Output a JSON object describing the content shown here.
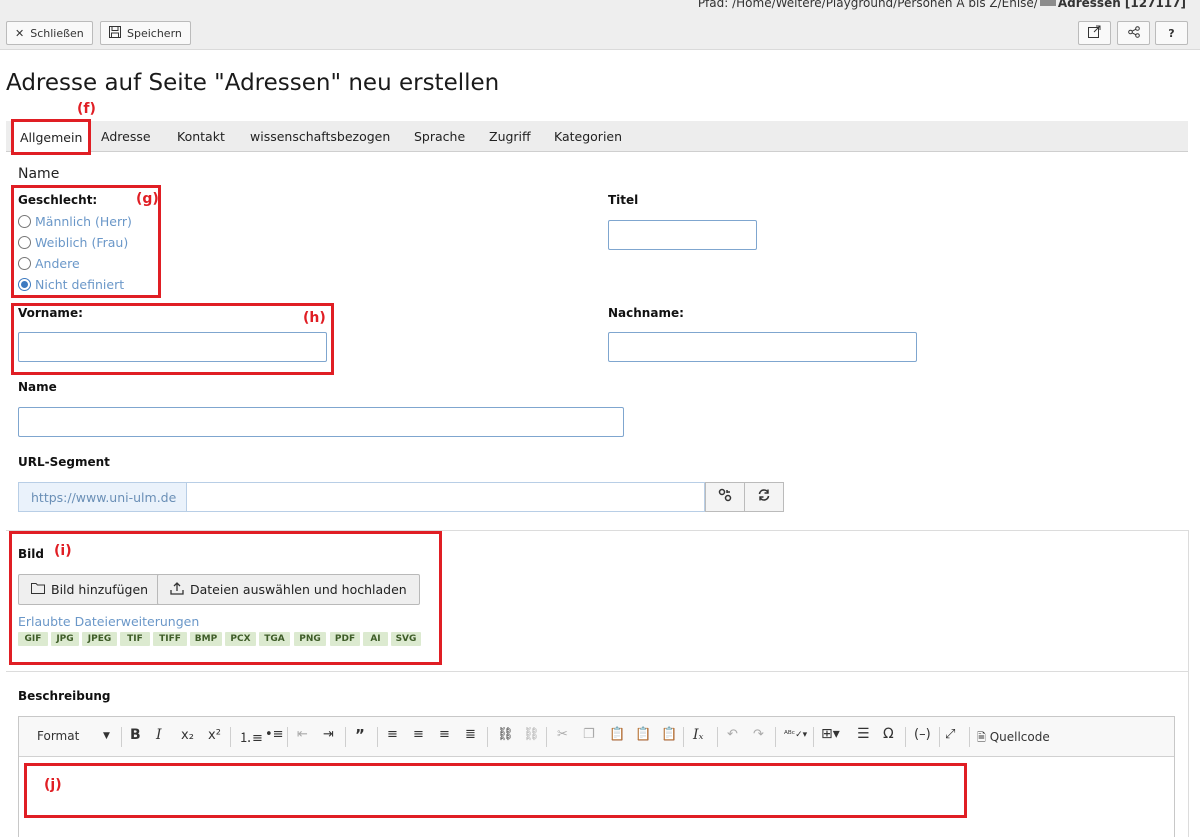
{
  "topbar": {
    "path_prefix": "Pfad: /Home/Weitere/Playground/Personen A bis Z/Enise/",
    "path_page": "Adressen [127117]",
    "close_label": "Schließen",
    "save_label": "Speichern",
    "help_label": "?"
  },
  "page_title": "Adresse auf Seite \"Adressen\" neu erstellen",
  "tabs": [
    {
      "label": "Allgemein",
      "active": true
    },
    {
      "label": "Adresse"
    },
    {
      "label": "Kontakt"
    },
    {
      "label": "wissenschaftsbezogen"
    },
    {
      "label": "Sprache"
    },
    {
      "label": "Zugriff"
    },
    {
      "label": "Kategorien"
    }
  ],
  "section_name": "Name",
  "gender": {
    "label": "Geschlecht:",
    "options": [
      "Männlich (Herr)",
      "Weiblich (Frau)",
      "Andere",
      "Nicht definiert"
    ],
    "selected": "Nicht definiert"
  },
  "fields": {
    "titel_label": "Titel",
    "titel_value": "",
    "vorname_label": "Vorname:",
    "vorname_value": "",
    "nachname_label": "Nachname:",
    "nachname_value": "",
    "name_label": "Name",
    "name_value": "",
    "url_label": "URL-Segment",
    "url_prefix": "https://www.uni-ulm.de",
    "url_value": ""
  },
  "bild": {
    "label": "Bild",
    "add_button": "Bild hinzufügen",
    "upload_button": "Dateien auswählen und hochladen",
    "allowed_label": "Erlaubte Dateierweiterungen",
    "extensions": [
      "GIF",
      "JPG",
      "JPEG",
      "TIF",
      "TIFF",
      "BMP",
      "PCX",
      "TGA",
      "PNG",
      "PDF",
      "AI",
      "SVG"
    ]
  },
  "beschreibung": {
    "label": "Beschreibung",
    "format_label": "Format",
    "source_label": "Quellcode"
  },
  "annotations": [
    "(f)",
    "(g)",
    "(h)",
    "(i)",
    "(j)"
  ],
  "colors": {
    "annotation": "#e01e24",
    "link": "#6a97c8",
    "radio_selected": "#3d7ac0",
    "extension_badge": "#dcead0"
  }
}
